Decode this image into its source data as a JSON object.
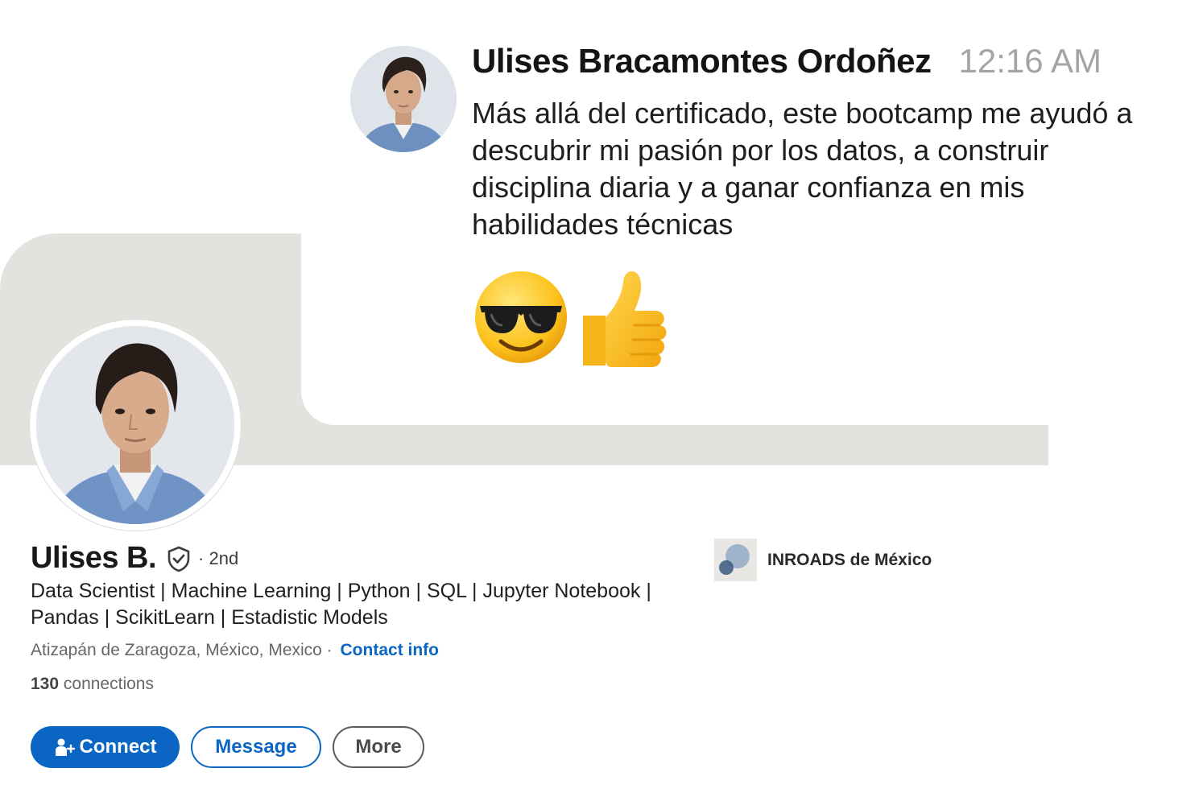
{
  "message": {
    "author": "Ulises Bracamontes Ordoñez",
    "time": "12:16 AM",
    "text": "Más allá del certificado, este bootcamp me ayudó a descubrir mi pasión por los datos, a construir disciplina diaria y a ganar confianza en mis habilidades técnicas",
    "emojis": [
      "smiling-face-with-sunglasses-icon",
      "thumbs-up-icon"
    ]
  },
  "profile": {
    "name": "Ulises B.",
    "degree": "· 2nd",
    "headline": "Data Scientist | Machine Learning | Python | SQL | Jupyter Notebook | Pandas | ScikitLearn | Estadistic Models",
    "location": "Atizapán de Zaragoza, México, Mexico ·",
    "contact_info": "Contact info",
    "connections_count": "130",
    "connections_label": "connections"
  },
  "company": {
    "name": "INROADS de México"
  },
  "actions": {
    "connect": "Connect",
    "message": "Message",
    "more": "More"
  },
  "colors": {
    "accent": "#0a66c2",
    "banner": "#e2e2de"
  }
}
